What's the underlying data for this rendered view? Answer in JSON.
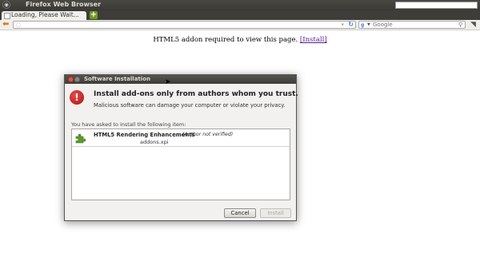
{
  "window": {
    "title": "Firefox Web Browser"
  },
  "tabs": [
    {
      "label": "Loading, Please Wait..."
    }
  ],
  "navbar": {
    "search_placeholder": "Google"
  },
  "page": {
    "message": "HTML5 addon required to view this page.",
    "install_link": "[Install]"
  },
  "dialog": {
    "title": "Software Installation",
    "heading": "Install add-ons only from authors whom you trust.",
    "subtext": "Malicious software can damage your computer or violate your privacy.",
    "list_label": "You have asked to install the following item:",
    "items": [
      {
        "name": "HTML5 Rendering Enhancements",
        "note": "(Author not verified)",
        "file": "addons.xpi"
      }
    ],
    "cancel_label": "Cancel",
    "install_label": "Install"
  },
  "colors": {
    "titlebar": "#3e3d39",
    "warning": "#c21d1d",
    "addon_icon": "#5b9a2a",
    "link": "#551a8b"
  }
}
